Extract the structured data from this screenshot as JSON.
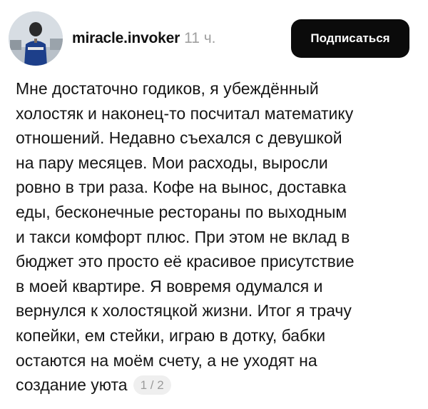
{
  "post": {
    "author": "miracle.invoker",
    "time": "11 ч.",
    "subscribe_label": "Подписаться",
    "lines": [
      "Мне достаточно годиков, я убеждённый",
      "холостяк и наконец-то посчитал математику",
      "отношений. Недавно съехался с девушкой",
      "на пару месяцев. Мои расходы, выросли",
      "ровно в три раза. Кофе на вынос, доставка",
      "еды, бесконечные рестораны по выходным",
      "и такси комфорт плюс. При этом не вклад в",
      "бюджет это просто её красивое присутствие",
      "в моей квартире. Я вовремя одумался и",
      "вернулся к холостяцкой жизни. Итог я трачу",
      "копейки, ем стейки, играю в дотку,  бабки",
      "остаются на моём счету, а не уходят на",
      "создание уюта"
    ],
    "page_indicator": "1 / 2"
  },
  "colors": {
    "button_bg": "#0b0b0b",
    "button_text": "#ffffff",
    "time_text": "#a0a0a0",
    "page_indicator_bg": "#efefef"
  },
  "icons": {
    "avatar": "avatar-photo"
  }
}
